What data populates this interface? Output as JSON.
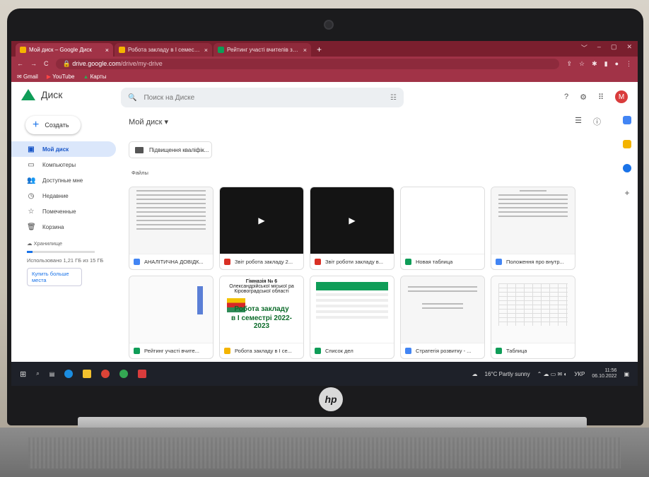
{
  "browser": {
    "tabs": [
      {
        "label": "Мой диск – Google Диск",
        "close": "×",
        "favicon_color": "#f4b400"
      },
      {
        "label": "Робота закладу в І семестрі 20...",
        "close": "×",
        "favicon_color": "#f4b400"
      },
      {
        "label": "Рейтинг участі вчителів заклад...",
        "close": "×",
        "favicon_color": "#0f9d58"
      }
    ],
    "new_tab": "+",
    "window_controls": [
      "﹀",
      "–",
      "▢",
      "✕"
    ],
    "url_host": "drive.google.com",
    "url_path": "/drive/my-drive",
    "back": "←",
    "forward": "→",
    "reload": "C",
    "bookmarks": [
      {
        "label": "Gmail",
        "icon": "gmail-icon"
      },
      {
        "label": "YouTube",
        "icon": "youtube-icon"
      },
      {
        "label": "Карты",
        "icon": "maps-icon"
      }
    ]
  },
  "drive": {
    "app_name": "Диск",
    "search_placeholder": "Поиск на Диске",
    "avatar_letter": "M",
    "create_label": "Создать",
    "nav": [
      {
        "label": "Мой диск",
        "icon": "▣",
        "active": true
      },
      {
        "label": "Компьютеры",
        "icon": "▭",
        "active": false
      },
      {
        "label": "Доступные мне",
        "icon": "👥",
        "active": false
      },
      {
        "label": "Недавние",
        "icon": "◷",
        "active": false
      },
      {
        "label": "Помеченные",
        "icon": "☆",
        "active": false
      },
      {
        "label": "Корзина",
        "icon": "🗑",
        "active": false
      }
    ],
    "storage_label": "Хранилище",
    "storage_used": "Использовано 1,21 ГБ из 15 ГБ",
    "storage_fraction": 0.08,
    "buy_more": "Купить больше места",
    "breadcrumb": "Мой диск ▾",
    "folders": [
      {
        "label": "Підвищення кваліфік..."
      }
    ],
    "files_section": "Файлы",
    "files": [
      {
        "name": "АНАЛІТИЧНА ДОВІДК...",
        "type": "doc",
        "icon_color": "#4285f4"
      },
      {
        "name": "Звіт робота закладу 2...",
        "type": "video",
        "icon_color": "#d93025"
      },
      {
        "name": "Звіт роботи закладу в...",
        "type": "video",
        "icon_color": "#d93025"
      },
      {
        "name": "Новая таблица",
        "type": "blank",
        "icon_color": "#0f9d58"
      },
      {
        "name": "Положення про внутр...",
        "type": "doc",
        "icon_color": "#4285f4"
      },
      {
        "name": "Рейтинг участі вчите...",
        "type": "sheet",
        "icon_color": "#0f9d58"
      },
      {
        "name": "Робота закладу в І се...",
        "type": "slide",
        "icon_color": "#f4b400"
      },
      {
        "name": "Список дел",
        "type": "green",
        "icon_color": "#0f9d58"
      },
      {
        "name": "Стратегія розвитку - ...",
        "type": "doc",
        "icon_color": "#4285f4"
      },
      {
        "name": "Таблица",
        "type": "sheet",
        "icon_color": "#0f9d58"
      }
    ],
    "slide_preview": {
      "line1": "Гімназія № 6",
      "line2": "Олександрійської міської ра",
      "line3": "Кіровоградської області",
      "title": "Робота закладу",
      "subtitle": "в І семестрі 2022-2023"
    }
  },
  "taskbar": {
    "weather": "16°C Partly sunny",
    "lang": "УКР",
    "time": "11:56",
    "date": "06.10.2022"
  },
  "brand": "hp"
}
